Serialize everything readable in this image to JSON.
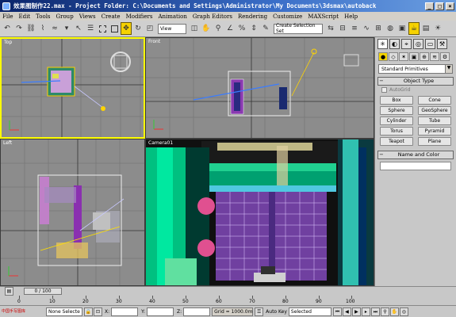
{
  "titlebar": {
    "title": "效果图制作22.max - Project Folder: C:\\Documents and Settings\\Administrator\\My Documents\\3dsmax\\autoback",
    "minimize": "_",
    "maximize": "□",
    "close": "×"
  },
  "menubar": {
    "items": [
      "File",
      "Edit",
      "Tools",
      "Group",
      "Views",
      "Create",
      "Modifiers",
      "Animation",
      "Graph Editors",
      "Rendering",
      "Customize",
      "MAXScript",
      "Help"
    ]
  },
  "toolbar": {
    "refcoord": "View",
    "selection_set": "Create Selection Set"
  },
  "viewports": {
    "top": {
      "label": "Top"
    },
    "front": {
      "label": "Front"
    },
    "left": {
      "label": "Left"
    },
    "camera": {
      "label": "Camera01"
    }
  },
  "command_panel": {
    "category": "Standard Primitives",
    "object_type_title": "Object Type",
    "autogrid_label": "AutoGrid",
    "buttons": [
      "Box",
      "Cone",
      "Sphere",
      "GeoSphere",
      "Cylinder",
      "Tube",
      "Torus",
      "Pyramid",
      "Teapot",
      "Plane"
    ],
    "name_color_title": "Name and Color"
  },
  "trackbar": {
    "frame": "0 / 100",
    "ticks": [
      "0",
      "10",
      "20",
      "30",
      "40",
      "50",
      "60",
      "70",
      "80",
      "90",
      "100"
    ]
  },
  "statusbar": {
    "logo_text": "中国手写图库",
    "selection": "None Selecte",
    "x_label": "X:",
    "y_label": "Y:",
    "z_label": "Z:",
    "grid": "Grid = 1000.0mm",
    "autokey": "Auto Key",
    "key_filter": "Selected"
  },
  "colors": {
    "active_border": "#ffff00",
    "title_bar": "#0a246a",
    "viewport_bg": "#8c8c8c"
  }
}
